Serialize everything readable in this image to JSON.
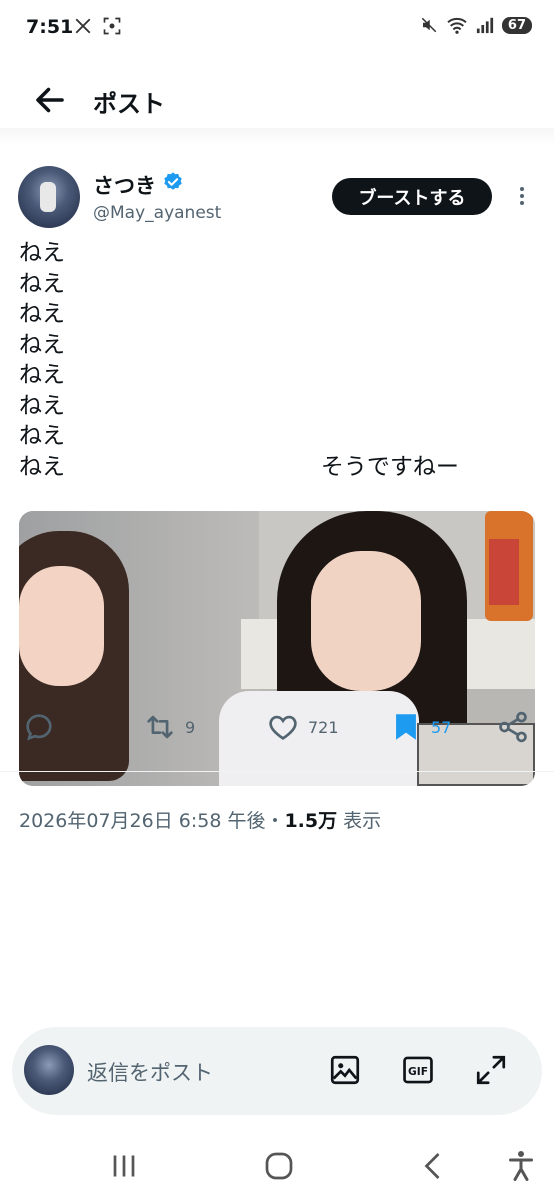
{
  "status_bar": {
    "time": "7:51",
    "battery": "67"
  },
  "header": {
    "title": "ポスト"
  },
  "post": {
    "display_name": "さつき",
    "handle": "@May_ayanest",
    "boost_label": "ブーストする",
    "text": "ねえ\nねえ\nねえ\nねえ\nねえ\nねえ\nねえ\nねえ                                   そうですねー",
    "timestamp": "2026年07月26日 6:58 午後・",
    "views_count": "1.5万",
    "views_label": "表示"
  },
  "actions": {
    "reply": "",
    "repost": "9",
    "like": "721",
    "bookmark": "57"
  },
  "colors": {
    "accent": "#1d9bf0",
    "muted": "#536471",
    "text": "#0f1419"
  },
  "reply_bar": {
    "placeholder": "返信をポスト"
  },
  "icons": [
    "back-arrow-icon",
    "verified-badge-icon",
    "more-vertical-icon",
    "reply-icon",
    "repost-icon",
    "like-icon",
    "bookmark-icon",
    "share-icon",
    "image-icon",
    "gif-icon",
    "expand-icon",
    "recents-icon",
    "home-icon",
    "back-icon",
    "accessibility-icon"
  ]
}
